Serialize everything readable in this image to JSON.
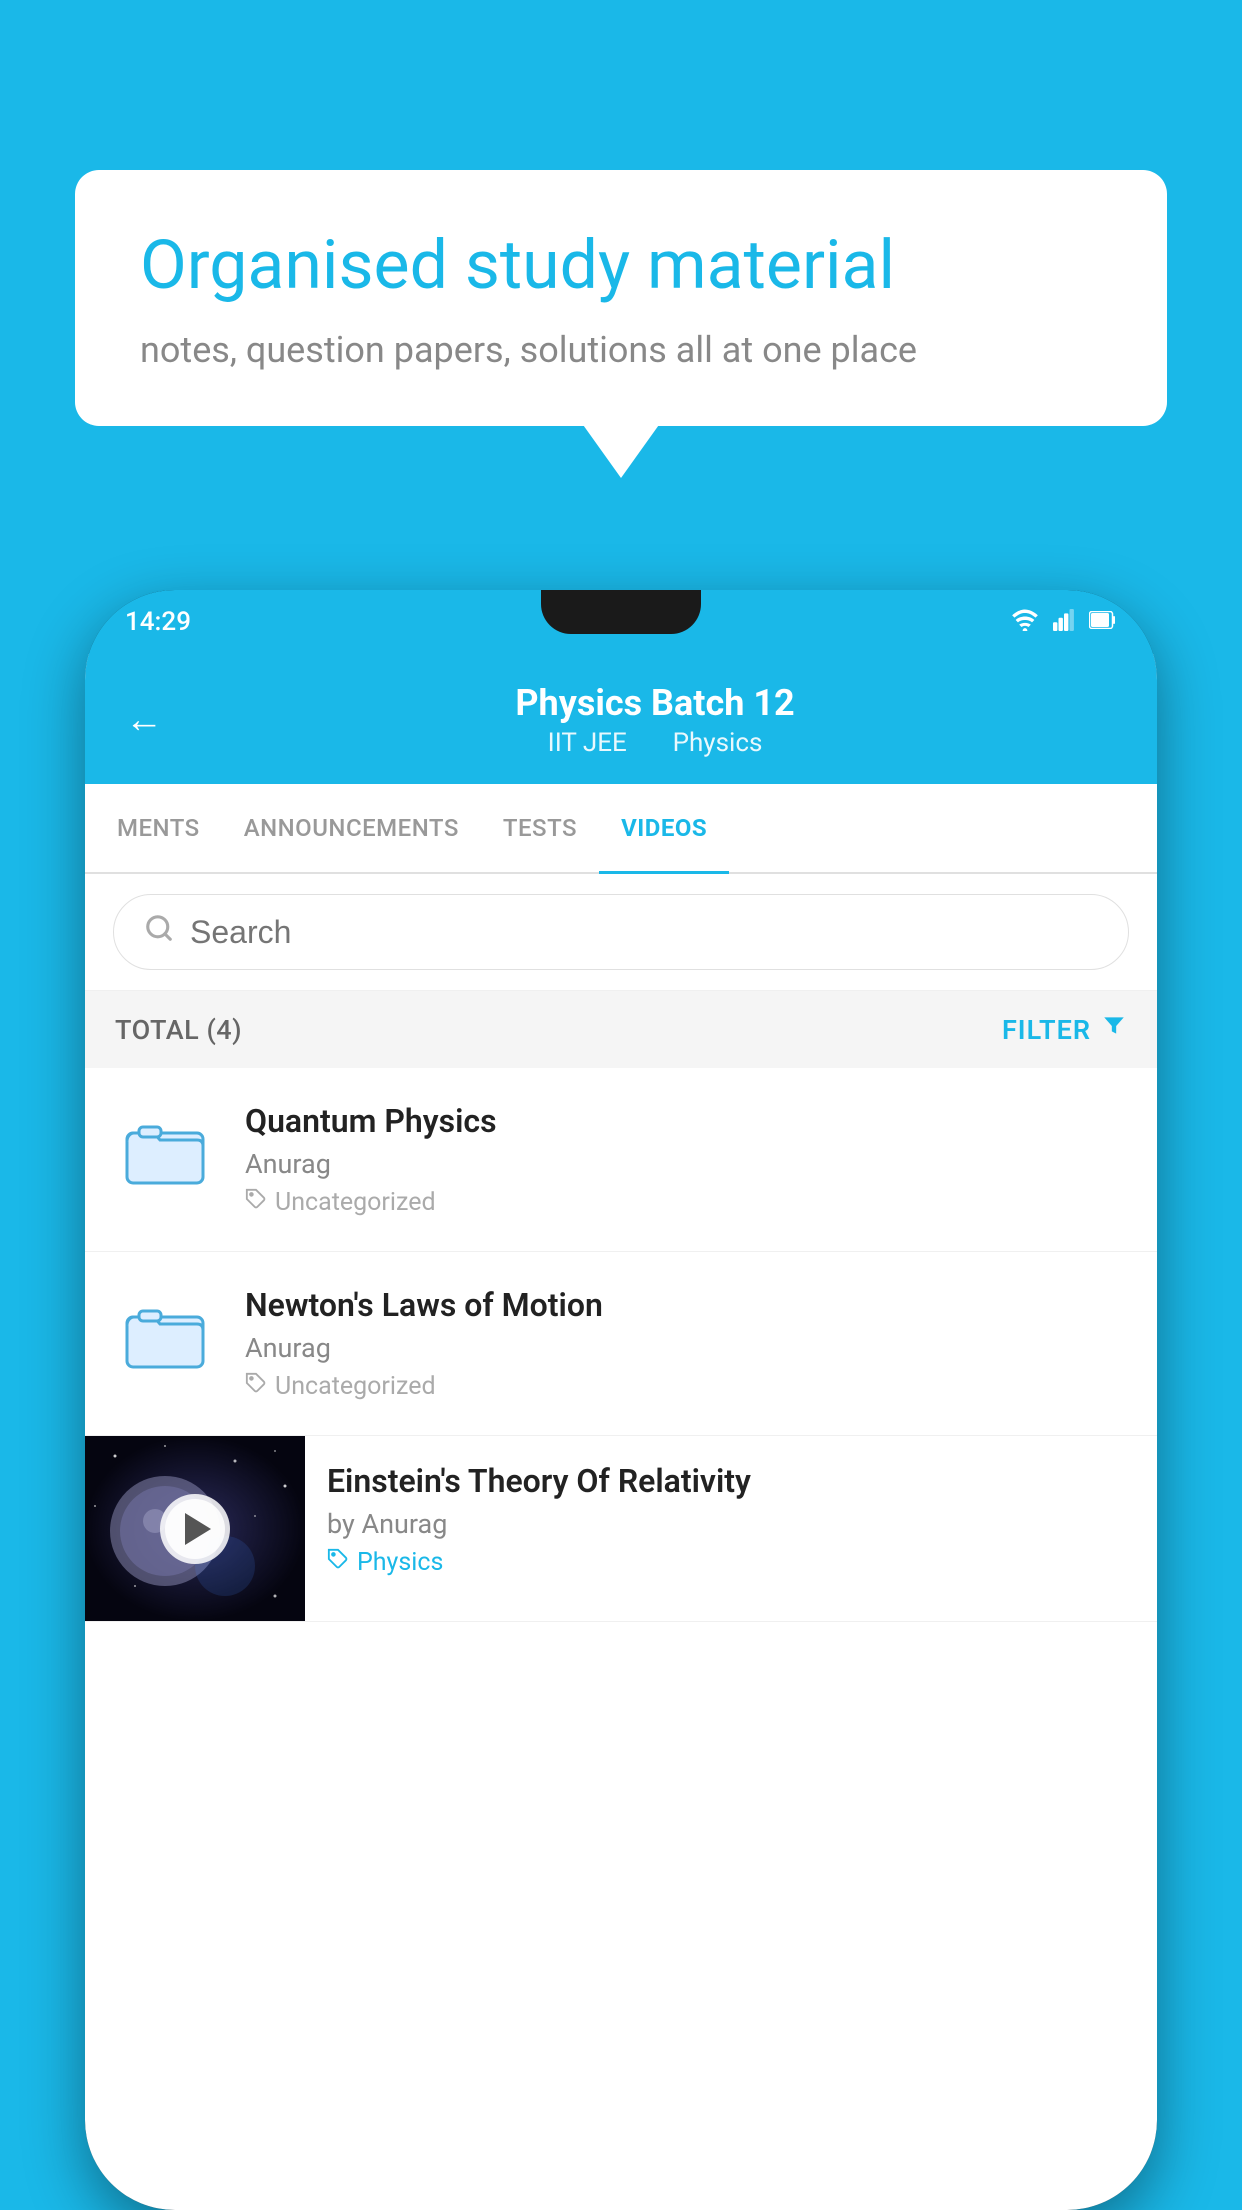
{
  "background_color": "#1ab8e8",
  "speech_bubble": {
    "title": "Organised study material",
    "subtitle": "notes, question papers, solutions all at one place"
  },
  "phone": {
    "status_bar": {
      "time": "14:29",
      "wifi": "▼",
      "signal": "▲",
      "battery": "▮"
    },
    "toolbar": {
      "back_label": "←",
      "title": "Physics Batch 12",
      "subtitle_part1": "IIT JEE",
      "subtitle_part2": "Physics"
    },
    "tabs": [
      {
        "label": "MENTS",
        "active": false
      },
      {
        "label": "ANNOUNCEMENTS",
        "active": false
      },
      {
        "label": "TESTS",
        "active": false
      },
      {
        "label": "VIDEOS",
        "active": true
      }
    ],
    "search": {
      "placeholder": "Search"
    },
    "filter_row": {
      "total_label": "TOTAL (4)",
      "filter_label": "FILTER"
    },
    "videos": [
      {
        "id": 1,
        "title": "Quantum Physics",
        "author": "Anurag",
        "tag": "Uncategorized",
        "type": "folder"
      },
      {
        "id": 2,
        "title": "Newton's Laws of Motion",
        "author": "Anurag",
        "tag": "Uncategorized",
        "type": "folder"
      },
      {
        "id": 3,
        "title": "Einstein's Theory Of Relativity",
        "author": "by Anurag",
        "tag": "Physics",
        "type": "video"
      }
    ]
  }
}
